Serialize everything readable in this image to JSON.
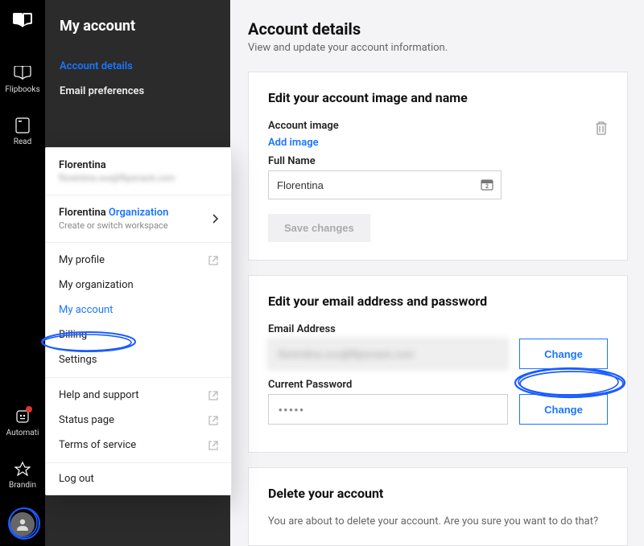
{
  "rail": {
    "items": [
      {
        "name": "flipbooks",
        "label": "Flipbooks"
      },
      {
        "name": "read",
        "label": "Read"
      },
      {
        "name": "automation",
        "label": "Automati"
      },
      {
        "name": "branding",
        "label": "Brandin"
      }
    ]
  },
  "sidebar": {
    "title": "My account",
    "links": [
      {
        "label": "Account details",
        "active": true
      },
      {
        "label": "Email preferences",
        "active": false
      }
    ]
  },
  "dropdown": {
    "userName": "Florentina",
    "userEmailMasked": "florentina.xxx@flipsnack.com",
    "orgName": "Florentina",
    "orgLabel": "Organization",
    "orgSub": "Create or switch workspace",
    "list1": [
      {
        "label": "My profile",
        "external": true,
        "active": false
      },
      {
        "label": "My organization",
        "external": false,
        "active": false
      },
      {
        "label": "My account",
        "external": false,
        "active": true
      },
      {
        "label": "Billing",
        "external": false,
        "active": false
      },
      {
        "label": "Settings",
        "external": false,
        "active": false
      }
    ],
    "list2": [
      {
        "label": "Help and support",
        "external": true
      },
      {
        "label": "Status page",
        "external": true
      },
      {
        "label": "Terms of service",
        "external": true
      }
    ],
    "logout": "Log out"
  },
  "page": {
    "title": "Account details",
    "subtitle": "View and update your account information."
  },
  "card1": {
    "title": "Edit your account image and name",
    "imgLabel": "Account image",
    "addImage": "Add image",
    "nameLabel": "Full Name",
    "nameValue": "Florentina",
    "saveBtn": "Save changes"
  },
  "card2": {
    "title": "Edit your email address and password",
    "emailLabel": "Email Address",
    "emailValue": "florentina.xxx@flipsnack.com",
    "pwLabel": "Current Password",
    "pwValue": "•••••",
    "changeBtn": "Change"
  },
  "card3": {
    "title": "Delete your account",
    "body": "You are about to delete your account. Are you sure you want to do that?"
  }
}
